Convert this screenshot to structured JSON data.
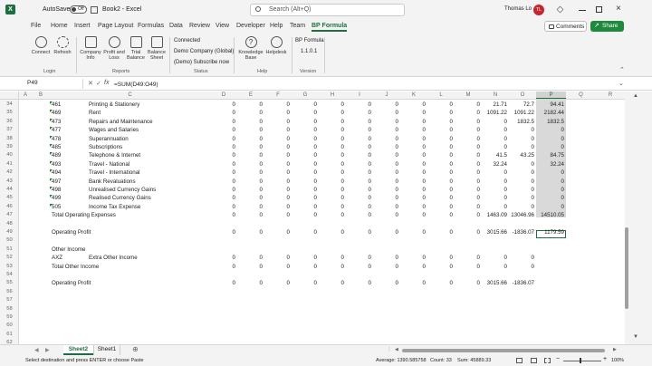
{
  "titlebar": {
    "autosave_label": "AutoSave",
    "autosave_state": "Off",
    "doc_title": "Book2 - Excel",
    "search_placeholder": "Search (Alt+Q)",
    "user_name": "Thomas Lo",
    "user_initials": "TL"
  },
  "menu": [
    "File",
    "Home",
    "Insert",
    "Page Layout",
    "Formulas",
    "Data",
    "Review",
    "View",
    "Developer",
    "Help",
    "Team",
    "BP Formula"
  ],
  "menu_active": "BP Formula",
  "comments_label": "Comments",
  "share_label": "Share",
  "ribbon": {
    "login": {
      "buttons": [
        "Connect",
        "Refresh"
      ],
      "group": "Login"
    },
    "reports": {
      "buttons": [
        "Company Info",
        "Profit and Loss",
        "Trial Balance",
        "Balance Sheet"
      ],
      "group": "Reports"
    },
    "status": {
      "lines": [
        "Connected",
        "Demo Company (Global)",
        "(Demo) Subscribe now"
      ],
      "group": "Status"
    },
    "help": {
      "buttons": [
        "Knowledge Base",
        "Helpdesk"
      ],
      "group": "Help"
    },
    "version": {
      "title": "BP Formula",
      "value": "1.1.0.1",
      "group": "Version"
    }
  },
  "namebox": "P49",
  "fx": "fx",
  "formula": "=SUM(D49:O49)",
  "columns": [
    "A",
    "B",
    "C",
    "D",
    "E",
    "F",
    "G",
    "H",
    "I",
    "J",
    "K",
    "L",
    "M",
    "N",
    "O",
    "P",
    "Q",
    "R"
  ],
  "rows": [
    {
      "r": "34",
      "a": "461",
      "b": "Printing & Stationery",
      "v": [
        "0",
        "0",
        "0",
        "0",
        "0",
        "0",
        "0",
        "0",
        "0",
        "0",
        "21.71",
        "72.7",
        "94.41"
      ],
      "tri": true
    },
    {
      "r": "35",
      "a": "469",
      "b": "Rent",
      "v": [
        "0",
        "0",
        "0",
        "0",
        "0",
        "0",
        "0",
        "0",
        "0",
        "0",
        "1091.22",
        "1091.22",
        "2182.44"
      ],
      "tri": true
    },
    {
      "r": "36",
      "a": "473",
      "b": "Repairs and Maintenance",
      "v": [
        "0",
        "0",
        "0",
        "0",
        "0",
        "0",
        "0",
        "0",
        "0",
        "0",
        "0",
        "1832.5",
        "1832.5"
      ],
      "tri": true
    },
    {
      "r": "37",
      "a": "477",
      "b": "Wages and Salaries",
      "v": [
        "0",
        "0",
        "0",
        "0",
        "0",
        "0",
        "0",
        "0",
        "0",
        "0",
        "0",
        "0",
        "0"
      ],
      "tri": true
    },
    {
      "r": "38",
      "a": "478",
      "b": "Superannuation",
      "v": [
        "0",
        "0",
        "0",
        "0",
        "0",
        "0",
        "0",
        "0",
        "0",
        "0",
        "0",
        "0",
        "0"
      ],
      "tri": true
    },
    {
      "r": "39",
      "a": "485",
      "b": "Subscriptions",
      "v": [
        "0",
        "0",
        "0",
        "0",
        "0",
        "0",
        "0",
        "0",
        "0",
        "0",
        "0",
        "0",
        "0"
      ],
      "tri": true
    },
    {
      "r": "40",
      "a": "489",
      "b": "Telephone & Internet",
      "v": [
        "0",
        "0",
        "0",
        "0",
        "0",
        "0",
        "0",
        "0",
        "0",
        "0",
        "41.5",
        "43.25",
        "84.75"
      ],
      "tri": true
    },
    {
      "r": "41",
      "a": "493",
      "b": "Travel - National",
      "v": [
        "0",
        "0",
        "0",
        "0",
        "0",
        "0",
        "0",
        "0",
        "0",
        "0",
        "32.24",
        "0",
        "32.24"
      ],
      "tri": true
    },
    {
      "r": "42",
      "a": "494",
      "b": "Travel - International",
      "v": [
        "0",
        "0",
        "0",
        "0",
        "0",
        "0",
        "0",
        "0",
        "0",
        "0",
        "0",
        "0",
        "0"
      ],
      "tri": true
    },
    {
      "r": "43",
      "a": "497",
      "b": "Bank Revaluations",
      "v": [
        "0",
        "0",
        "0",
        "0",
        "0",
        "0",
        "0",
        "0",
        "0",
        "0",
        "0",
        "0",
        "0"
      ],
      "tri": true
    },
    {
      "r": "44",
      "a": "498",
      "b": "Unrealised Currency Gains",
      "v": [
        "0",
        "0",
        "0",
        "0",
        "0",
        "0",
        "0",
        "0",
        "0",
        "0",
        "0",
        "0",
        "0"
      ],
      "tri": true
    },
    {
      "r": "45",
      "a": "499",
      "b": "Realised Currency Gains",
      "v": [
        "0",
        "0",
        "0",
        "0",
        "0",
        "0",
        "0",
        "0",
        "0",
        "0",
        "0",
        "0",
        "0"
      ],
      "tri": true
    },
    {
      "r": "46",
      "a": "505",
      "b": "Income Tax Expense",
      "v": [
        "0",
        "0",
        "0",
        "0",
        "0",
        "0",
        "0",
        "0",
        "0",
        "0",
        "0",
        "0",
        "0"
      ],
      "tri": true
    },
    {
      "r": "47",
      "a": "Total Operating Expenses",
      "b": "",
      "v": [
        "0",
        "0",
        "0",
        "0",
        "0",
        "0",
        "0",
        "0",
        "0",
        "0",
        "1463.09",
        "13046.96",
        "14510.05"
      ]
    },
    {
      "r": "48",
      "a": "",
      "b": "",
      "v": []
    },
    {
      "r": "49",
      "a": "Operating Profit",
      "b": "",
      "v": [
        "0",
        "0",
        "0",
        "0",
        "0",
        "0",
        "0",
        "0",
        "0",
        "0",
        "3015.66",
        "-1836.07",
        "1179.59"
      ]
    },
    {
      "r": "50",
      "a": "",
      "b": "",
      "v": []
    },
    {
      "r": "51",
      "a": "Other Income",
      "b": "",
      "v": []
    },
    {
      "r": "52",
      "a": "AXZ",
      "b": "Extra Other Income",
      "v": [
        "0",
        "0",
        "0",
        "0",
        "0",
        "0",
        "0",
        "0",
        "0",
        "0",
        "0",
        "0",
        ""
      ]
    },
    {
      "r": "53",
      "a": "Total Other Income",
      "b": "",
      "v": [
        "0",
        "0",
        "0",
        "0",
        "0",
        "0",
        "0",
        "0",
        "0",
        "0",
        "0",
        "0",
        ""
      ]
    },
    {
      "r": "54",
      "a": "",
      "b": "",
      "v": []
    },
    {
      "r": "55",
      "a": "Operating Profit",
      "b": "",
      "v": [
        "0",
        "0",
        "0",
        "0",
        "0",
        "0",
        "0",
        "0",
        "0",
        "0",
        "3015.66",
        "-1836.07",
        ""
      ]
    },
    {
      "r": "56",
      "a": "",
      "b": "",
      "v": []
    },
    {
      "r": "57",
      "a": "",
      "b": "",
      "v": []
    },
    {
      "r": "58",
      "a": "",
      "b": "",
      "v": []
    },
    {
      "r": "59",
      "a": "",
      "b": "",
      "v": []
    },
    {
      "r": "60",
      "a": "",
      "b": "",
      "v": []
    },
    {
      "r": "61",
      "a": "",
      "b": "",
      "v": []
    },
    {
      "r": "62",
      "a": "",
      "b": "",
      "v": []
    }
  ],
  "sheets": [
    "Sheet2",
    "Sheet1"
  ],
  "active_sheet": "Sheet2",
  "status": {
    "message": "Select destination and press ENTER or choose Paste",
    "average": "Average: 1390.585758",
    "count": "Count: 33",
    "sum": "Sum: 45889.33",
    "zoom": "100%"
  },
  "colors": {
    "excel_green": "#1d6f42",
    "share_green": "#1e8a3e",
    "selection_gray": "#d9d9d9",
    "avatar": "#c4262e"
  }
}
